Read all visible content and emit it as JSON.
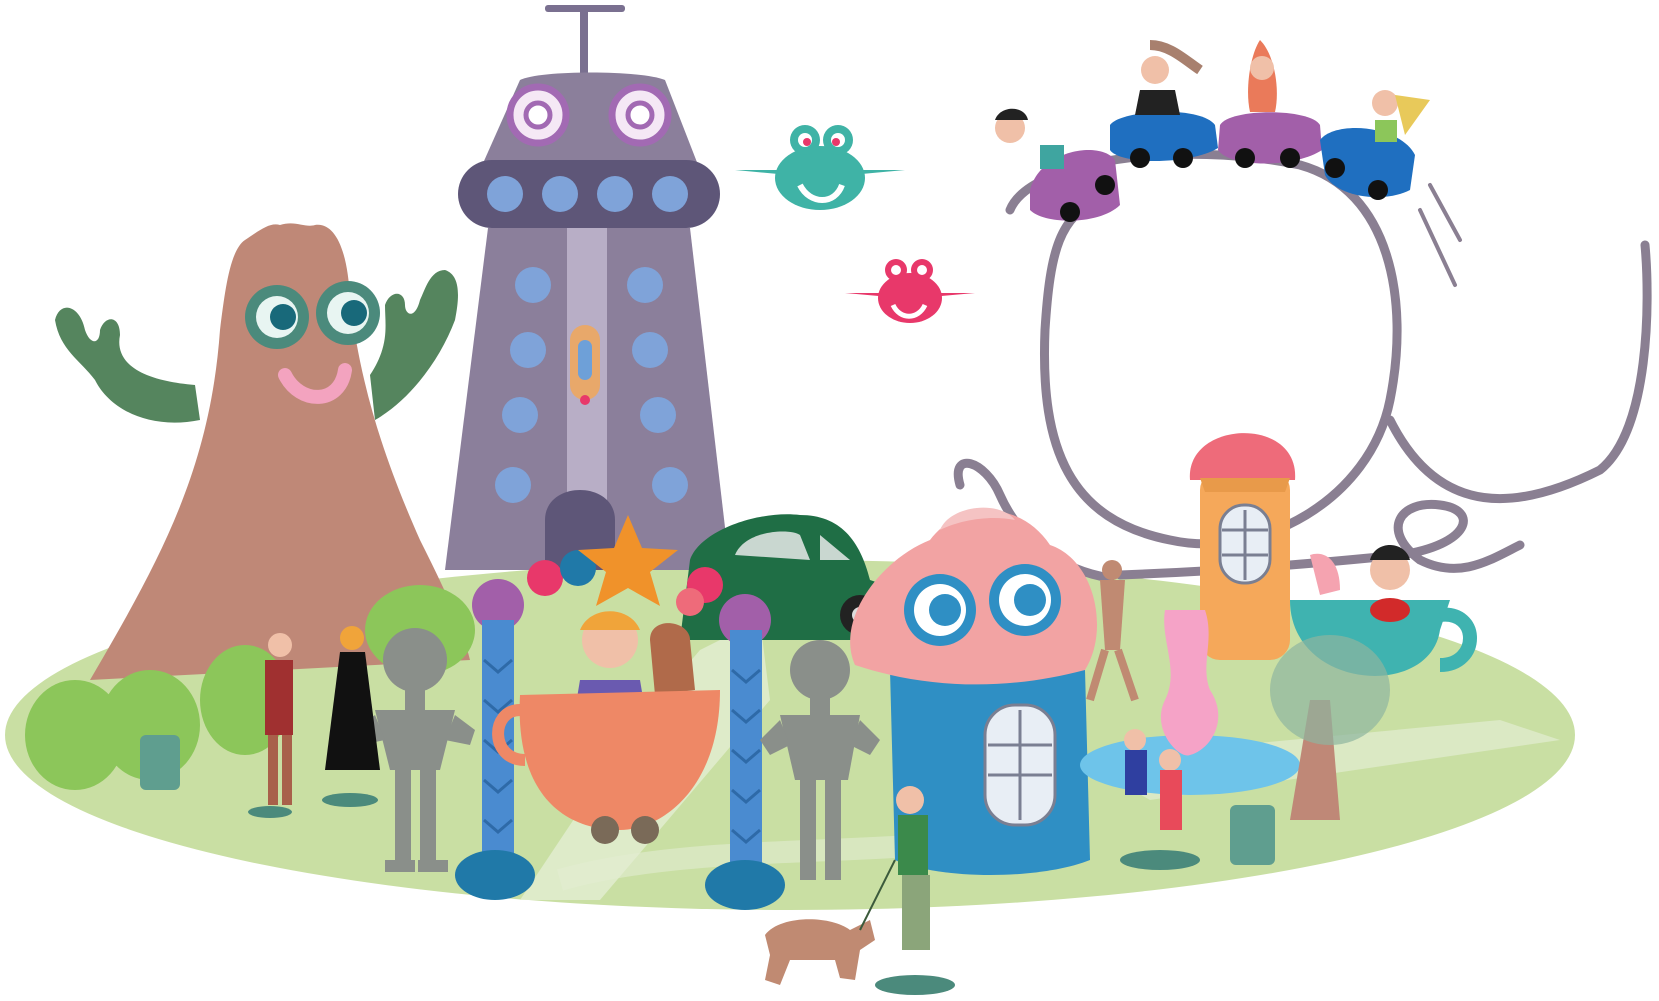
{
  "scene": {
    "description_kind": "illustration",
    "palette": {
      "ground": "#c9dfa3",
      "ground_edge": "#b4d08a",
      "path": "#e8f0d8",
      "tree_monster": "#bf8877",
      "tree_arms": "#55855e",
      "tower": "#8b7f9b",
      "tower_dark": "#5e5678",
      "tower_windows": "#7fa3d9",
      "coaster_track": "#8a7f92",
      "cupcake_top": "#f2a3a3",
      "cupcake_base": "#2f8fc4",
      "teacup_orange": "#ee8866",
      "teacup_teal": "#3fb3b0",
      "car_green": "#1f6e45",
      "coaster_blue": "#1f6fc0",
      "coaster_purple": "#a25fa9",
      "robot_gray": "#8a8f8a",
      "ufo_teal": "#3fb3a6",
      "ufo_pink": "#e8386a",
      "mushroom_tower": "#f5a85a",
      "mushroom_cap": "#ee6b7a",
      "fountain_pink": "#f5a3c7",
      "pond": "#6ec4ea",
      "bush": "#8cc65a",
      "star": "#f0922a"
    },
    "icons": [
      "tree-monster-icon",
      "rocket-tower-icon",
      "roller-coaster-icon",
      "ufo-icon",
      "cupcake-house-icon",
      "teacup-ride-icon",
      "robot-statue-icon",
      "car-icon",
      "dog-icon",
      "star-icon"
    ]
  }
}
